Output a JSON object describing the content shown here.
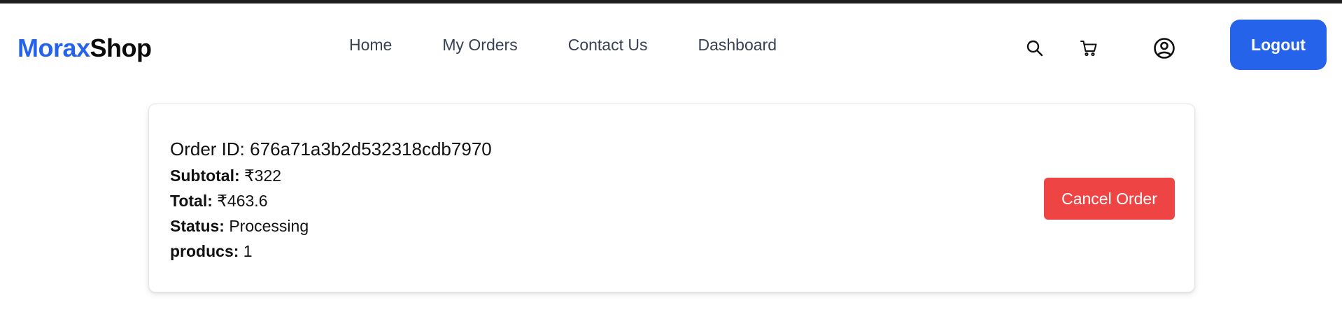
{
  "brand": {
    "part1": "Morax",
    "part2": "Shop",
    "accent_color": "#2563eb"
  },
  "nav": {
    "links": [
      "Home",
      "My Orders",
      "Contact Us",
      "Dashboard"
    ],
    "icons": [
      "search-icon",
      "cart-icon",
      "user-icon"
    ],
    "logout_label": "Logout"
  },
  "order": {
    "id_label": "Order ID:",
    "id": "676a71a3b2d532318cdb7970",
    "subtotal_label": "Subtotal:",
    "subtotal": "₹322",
    "total_label": "Total:",
    "total": "₹463.6",
    "status_label": "Status:",
    "status": "Processing",
    "products_label": "producs:",
    "products": "1",
    "cancel_label": "Cancel Order",
    "cancel_color": "#ef4444"
  }
}
